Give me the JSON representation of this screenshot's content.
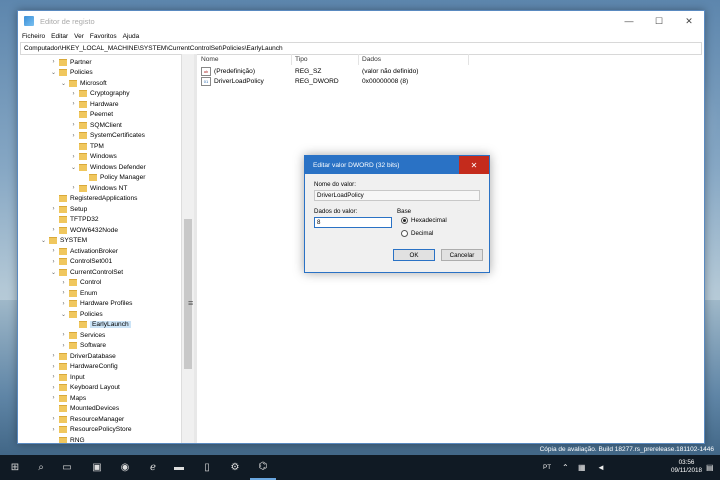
{
  "window": {
    "title": "Editor de registo",
    "controls": {
      "minimize": "—",
      "maximize": "☐",
      "close": "✕"
    }
  },
  "menu": [
    "Ficheiro",
    "Editar",
    "Ver",
    "Favoritos",
    "Ajuda"
  ],
  "address": "Computador\\HKEY_LOCAL_MACHINE\\SYSTEM\\CurrentControlSet\\Policies\\EarlyLaunch",
  "tree": [
    {
      "label": "Partner",
      "level": 2,
      "expand": "›"
    },
    {
      "label": "Policies",
      "level": 2,
      "expand": "⌄"
    },
    {
      "label": "Microsoft",
      "level": 3,
      "expand": "⌄"
    },
    {
      "label": "Cryptography",
      "level": 4,
      "expand": "›"
    },
    {
      "label": "Hardware",
      "level": 4,
      "expand": "›"
    },
    {
      "label": "Peernet",
      "level": 4,
      "expand": ""
    },
    {
      "label": "SQMClient",
      "level": 4,
      "expand": "›"
    },
    {
      "label": "SystemCertificates",
      "level": 4,
      "expand": "›"
    },
    {
      "label": "TPM",
      "level": 4,
      "expand": ""
    },
    {
      "label": "Windows",
      "level": 4,
      "expand": "›"
    },
    {
      "label": "Windows Defender",
      "level": 4,
      "expand": "⌄"
    },
    {
      "label": "Policy Manager",
      "level": 5,
      "expand": ""
    },
    {
      "label": "Windows NT",
      "level": 4,
      "expand": "›"
    },
    {
      "label": "RegisteredApplications",
      "level": 2,
      "expand": ""
    },
    {
      "label": "Setup",
      "level": 2,
      "expand": "›"
    },
    {
      "label": "TFTPD32",
      "level": 2,
      "expand": ""
    },
    {
      "label": "WOW6432Node",
      "level": 2,
      "expand": "›"
    },
    {
      "label": "SYSTEM",
      "level": 1,
      "expand": "⌄"
    },
    {
      "label": "ActivationBroker",
      "level": 2,
      "expand": "›"
    },
    {
      "label": "ControlSet001",
      "level": 2,
      "expand": "›"
    },
    {
      "label": "CurrentControlSet",
      "level": 2,
      "expand": "⌄"
    },
    {
      "label": "Control",
      "level": 3,
      "expand": "›"
    },
    {
      "label": "Enum",
      "level": 3,
      "expand": "›"
    },
    {
      "label": "Hardware Profiles",
      "level": 3,
      "expand": "›"
    },
    {
      "label": "Policies",
      "level": 3,
      "expand": "⌄"
    },
    {
      "label": "EarlyLaunch",
      "level": 4,
      "expand": "",
      "selected": true
    },
    {
      "label": "Services",
      "level": 3,
      "expand": "›"
    },
    {
      "label": "Software",
      "level": 3,
      "expand": "›"
    },
    {
      "label": "DriverDatabase",
      "level": 2,
      "expand": "›"
    },
    {
      "label": "HardwareConfig",
      "level": 2,
      "expand": "›"
    },
    {
      "label": "Input",
      "level": 2,
      "expand": "›"
    },
    {
      "label": "Keyboard Layout",
      "level": 2,
      "expand": "›"
    },
    {
      "label": "Maps",
      "level": 2,
      "expand": "›"
    },
    {
      "label": "MountedDevices",
      "level": 2,
      "expand": ""
    },
    {
      "label": "ResourceManager",
      "level": 2,
      "expand": "›"
    },
    {
      "label": "ResourcePolicyStore",
      "level": 2,
      "expand": "›"
    },
    {
      "label": "RNG",
      "level": 2,
      "expand": ""
    }
  ],
  "list": {
    "headers": [
      "Nome",
      "Tipo",
      "Dados"
    ],
    "rows": [
      {
        "name": "(Predefinição)",
        "type": "REG_SZ",
        "data": "(valor não definido)",
        "icon": "string-value-icon",
        "glyph": "ab"
      },
      {
        "name": "DriverLoadPolicy",
        "type": "REG_DWORD",
        "data": "0x00000008 (8)",
        "icon": "binary-value-icon",
        "glyph": "01"
      }
    ]
  },
  "dialog": {
    "title": "Editar valor DWORD (32 bits)",
    "name_label": "Nome do valor:",
    "name_value": "DriverLoadPolicy",
    "data_label": "Dados do valor:",
    "data_value": "8",
    "base_label": "Base",
    "base_hex": "Hexadecimal",
    "base_dec": "Decimal",
    "selected_base": "Hexadecimal",
    "ok": "OK",
    "cancel": "Cancelar",
    "close": "✕"
  },
  "watermark": {
    "line1": "Cópia de avaliação. Build 18277.rs_prerelease.181102-1446"
  },
  "taskbar": {
    "icons": [
      {
        "name": "start-icon",
        "glyph": "⊞"
      },
      {
        "name": "search-icon",
        "glyph": "⌕"
      },
      {
        "name": "task-view-icon",
        "glyph": "▭"
      },
      {
        "name": "taskbar-app-icon",
        "glyph": "▣"
      },
      {
        "name": "chrome-icon",
        "glyph": "◉"
      },
      {
        "name": "edge-icon",
        "glyph": "ℯ"
      },
      {
        "name": "file-explorer-icon",
        "glyph": "▬"
      },
      {
        "name": "phone-icon",
        "glyph": "▯"
      },
      {
        "name": "settings-icon",
        "glyph": "⚙"
      },
      {
        "name": "regedit-icon",
        "glyph": "⌬"
      }
    ],
    "language": "PT",
    "time": "03:56",
    "date": "09/11/2018",
    "tray_up": "⌃",
    "network": "▦",
    "volume": "◄",
    "notifications": "▤"
  }
}
